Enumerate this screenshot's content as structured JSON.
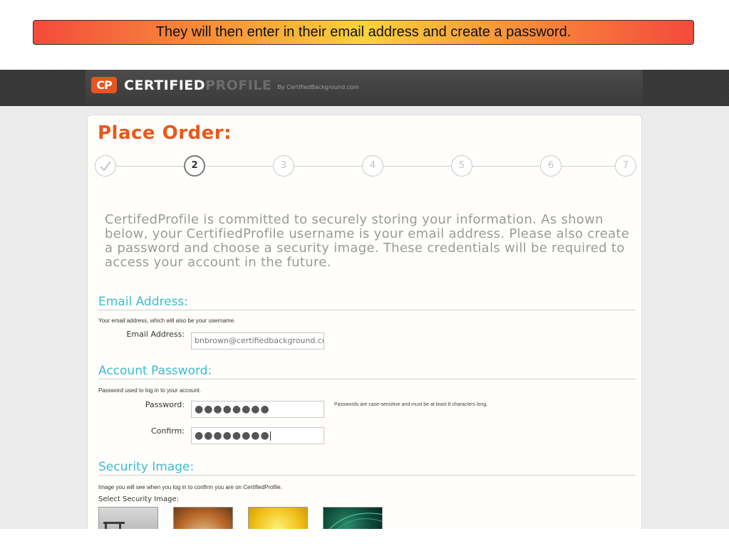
{
  "callout": {
    "text": "They will then enter in their email address and create a password."
  },
  "brand": {
    "cp": "CP",
    "certified": "CERTIFIED",
    "profile": "PROFILE",
    "by": "By CertifiedBackground.com"
  },
  "page": {
    "title": "Place Order:"
  },
  "steps": [
    {
      "label": "",
      "state": "done"
    },
    {
      "label": "2",
      "state": "current"
    },
    {
      "label": "3",
      "state": "upcoming"
    },
    {
      "label": "4",
      "state": "upcoming"
    },
    {
      "label": "5",
      "state": "upcoming"
    },
    {
      "label": "6",
      "state": "upcoming"
    },
    {
      "label": "7",
      "state": "upcoming"
    }
  ],
  "intro": "CertifedProfile is committed to securely storing your information. As shown below, your CertifiedProfile username is your email address. Please also create a password and choose a security image. These credentials will be required to access your account in the future.",
  "email_section": {
    "heading": "Email Address:",
    "help": "Your email address, which will also be your username.",
    "label": "Email Address:",
    "value": "bnbrown@certifiedbackground.com"
  },
  "password_section": {
    "heading": "Account Password:",
    "help": "Password used to log in to your account.",
    "password_label": "Password:",
    "password_value": "●●●●●●●●",
    "hint": "Passwords are case-sensitive and must be at least 8 characters long.",
    "confirm_label": "Confirm:",
    "confirm_value": "●●●●●●●●"
  },
  "security_section": {
    "heading": "Security Image:",
    "help": "Image you will see when you log in to confirm you are on CertifiedProfile.",
    "select_label": "Select Security Image:"
  },
  "colors": {
    "accent_orange": "#e8581c",
    "section_teal": "#3dbccf"
  }
}
